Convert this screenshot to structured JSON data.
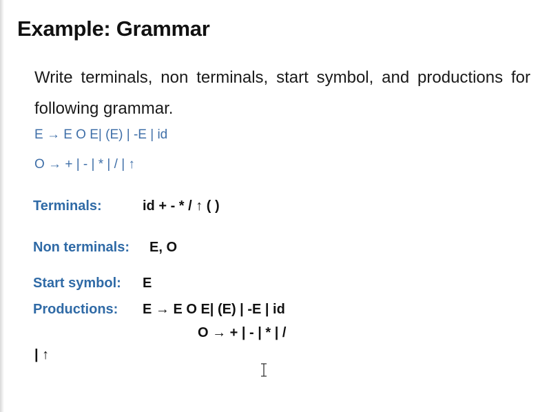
{
  "slide": {
    "title": "Example: Grammar",
    "intro": "Write terminals, non terminals, start symbol, and productions for following grammar.",
    "grammar": [
      "E → E O E| (E) | -E | id",
      "O → + | - | * | / | ↑"
    ],
    "terminals": {
      "label": "Terminals:",
      "value": "id + - * / ↑ ( )"
    },
    "non_terminals": {
      "label": "Non terminals:",
      "value": "E, O"
    },
    "start_symbol": {
      "label": "Start symbol:",
      "value": "E"
    },
    "productions": {
      "label": "Productions:",
      "lines": [
        "E → E O E| (E) | -E | id",
        "O → + | - | * | /",
        "| ↑"
      ]
    },
    "colors": {
      "label_blue": "#2f6aa6",
      "grammar_blue": "#3f6fa8",
      "text": "#1a1a1a"
    }
  }
}
